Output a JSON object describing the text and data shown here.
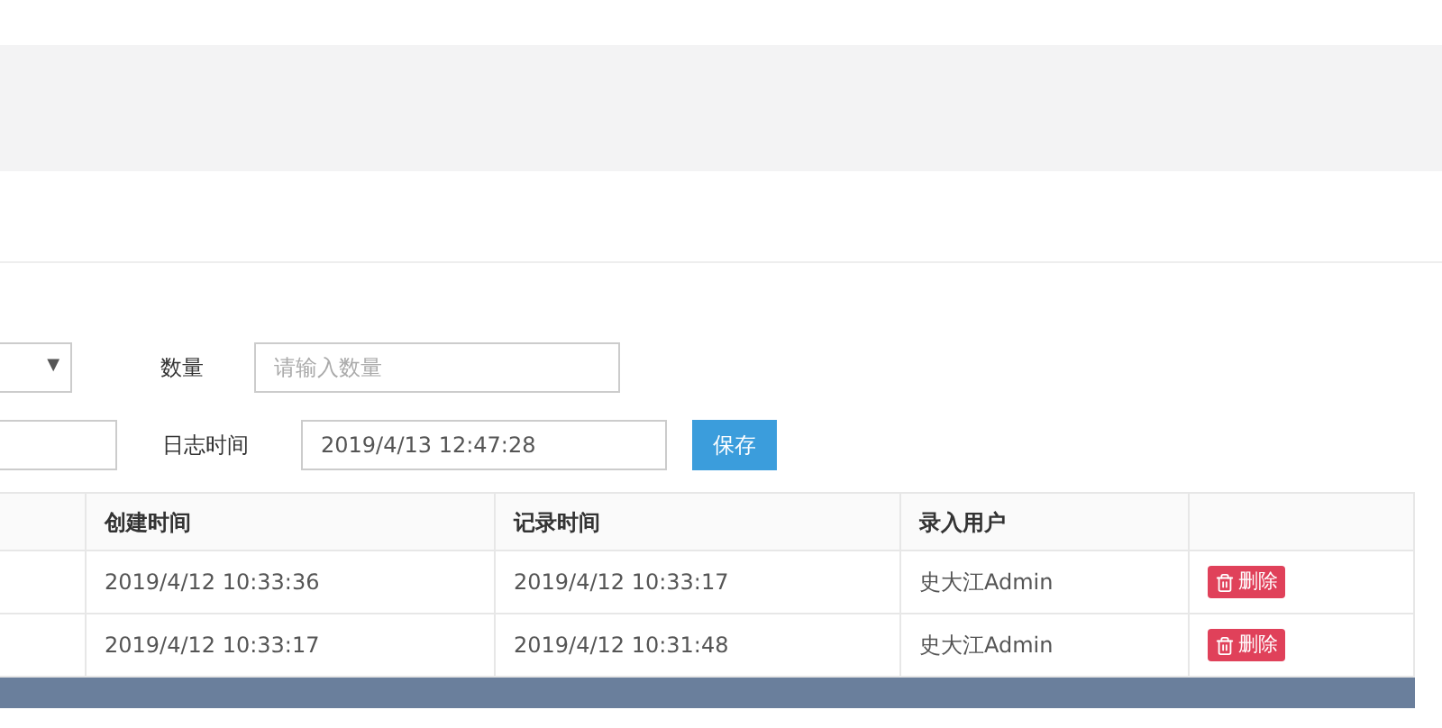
{
  "form": {
    "select_arrow": "▼",
    "quantity": {
      "label": "数量",
      "placeholder": "请输入数量"
    },
    "log_time": {
      "label": "日志时间",
      "value": "2019/4/13 12:47:28"
    },
    "save_button": "保存"
  },
  "table": {
    "columns": [
      "创建时间",
      "记录时间",
      "录入用户"
    ],
    "rows": [
      {
        "cells": [
          "2019/4/12 10:33:36",
          "2019/4/12 10:33:17",
          "史大江Admin"
        ],
        "action": "删除"
      },
      {
        "cells": [
          "2019/4/12 10:33:17",
          "2019/4/12 10:31:48",
          "史大江Admin"
        ],
        "action": "删除"
      }
    ]
  }
}
